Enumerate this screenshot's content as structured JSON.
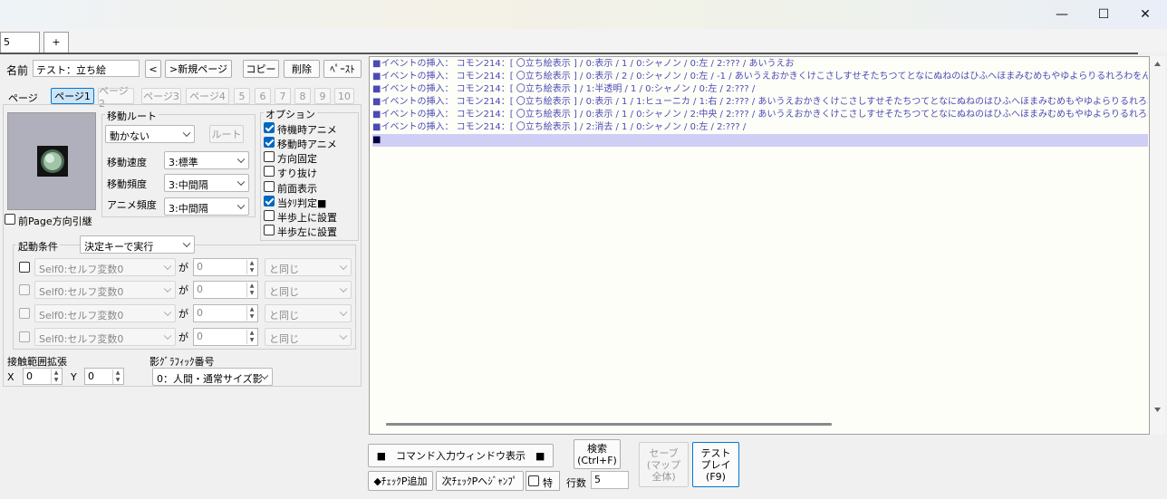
{
  "window": {
    "minimize_glyph": "—",
    "maximize_glyph": "☐",
    "close_glyph": "✕"
  },
  "tabs": [
    {
      "label": "5"
    },
    {
      "label": "+"
    }
  ],
  "event": {
    "name_label": "名前",
    "name_value": "テスト：立ち絵",
    "prev_button": "<",
    "new_page_button": ">新規ページ",
    "copy_button": "コピー",
    "delete_button": "削除",
    "paste_button": "ﾍﾟｰｽﾄ",
    "page_label": "ページ",
    "pages": [
      "ページ1",
      "ページ2",
      "ページ3",
      "ページ4",
      "5",
      "6",
      "7",
      "8",
      "9",
      "10"
    ]
  },
  "movement": {
    "header": "移動ルート",
    "route_value": "動かない",
    "route_button": "ルート",
    "speed_label": "移動速度",
    "speed_value": "3:標準",
    "freq_label": "移動頻度",
    "freq_value": "3:中間隔",
    "anim_label": "アニメ頻度",
    "anim_value": "3:中間隔"
  },
  "options": {
    "header": "オプション",
    "items": [
      {
        "label": "待機時アニメ",
        "checked": true
      },
      {
        "label": "移動時アニメ",
        "checked": true
      },
      {
        "label": "方向固定",
        "checked": false
      },
      {
        "label": "すり抜け",
        "checked": false
      },
      {
        "label": "前面表示",
        "checked": false
      },
      {
        "label": "当ﾀﾘ判定■",
        "checked": true
      },
      {
        "label": "半歩上に設置",
        "checked": false
      },
      {
        "label": "半歩左に設置",
        "checked": false
      }
    ]
  },
  "prev_page_dir": "前Page方向引継",
  "trigger": {
    "header": "起動条件",
    "value": "決定キーで実行",
    "rows": [
      {
        "var": "Self0:セルフ変数0",
        "ga": "が",
        "num": "0",
        "cond": "と同じ"
      },
      {
        "var": "Self0:セルフ変数0",
        "ga": "が",
        "num": "0",
        "cond": "と同じ"
      },
      {
        "var": "Self0:セルフ変数0",
        "ga": "が",
        "num": "0",
        "cond": "と同じ"
      },
      {
        "var": "Self0:セルフ変数0",
        "ga": "が",
        "num": "0",
        "cond": "と同じ"
      }
    ]
  },
  "contact": {
    "header": "接触範囲拡張",
    "x_label": "X",
    "x_value": "0",
    "y_label": "Y",
    "y_value": "0"
  },
  "shadow": {
    "header": "影ｸﾞﾗﾌｨｯｸ番号",
    "value": "0：人間・通常サイズ影"
  },
  "commands": [
    "■イベントの挿入： コモン214：[ 〇立ち絵表示 ] / 0:表示 / 1 / 0:シャノン / 0:左 / 2:??? / あいうえお",
    "■イベントの挿入： コモン214：[ 〇立ち絵表示 ] / 0:表示 / 2 / 0:シャノン / 0:左 / -1 / あいうえおかきくけこさしすせそたちつてとなにぬねのはひふへほまみむめもやゆよらりるれろわをん！？",
    "■イベントの挿入： コモン214：[ 〇立ち絵表示 ] / 1:半透明 / 1 / 0:シャノン / 0:左 / 2:??? /",
    "■イベントの挿入： コモン214：[ 〇立ち絵表示 ] / 0:表示 / 1 / 1:ヒューニカ / 1:右 / 2:??? / あいうえおかきくけこさしすせそたちつてとなにぬねのはひふへほまみむめもやゆよらりるれろわをん！",
    "■イベントの挿入： コモン214：[ 〇立ち絵表示 ] / 0:表示 / 1 / 0:シャノン / 2:中央 / 2:??? / あいうえおかきくけこさしすせそたちつてとなにぬねのはひふへほまみむめもやゆよらりるれろわをん！",
    "■イベントの挿入： コモン214：[ 〇立ち絵表示 ] / 2:消去 / 1 / 0:シャノン / 0:左 / 2:??? /",
    "■"
  ],
  "bottom": {
    "cmd_window_button": "■　コマンド入力ウィンドウ表示　■",
    "search_button_1": "検索",
    "search_button_2": "(Ctrl+F)",
    "save_button_1": "セーブ",
    "save_button_2": "(マップ",
    "save_button_3": "全体)",
    "test_button_1": "テスト",
    "test_button_2": "プレイ",
    "test_button_3": "(F9)",
    "check_add_button": "◆ﾁｪｯｸP追加",
    "next_check_button": "次ﾁｪｯｸPへｼﾞｬﾝﾌﾟ",
    "special_label": "特",
    "lines_label": "行数",
    "lines_value": "5"
  },
  "colors": {
    "accent": "#0067c0",
    "command_text": "#4a4ab8",
    "selected_line": "#cfcff5"
  }
}
